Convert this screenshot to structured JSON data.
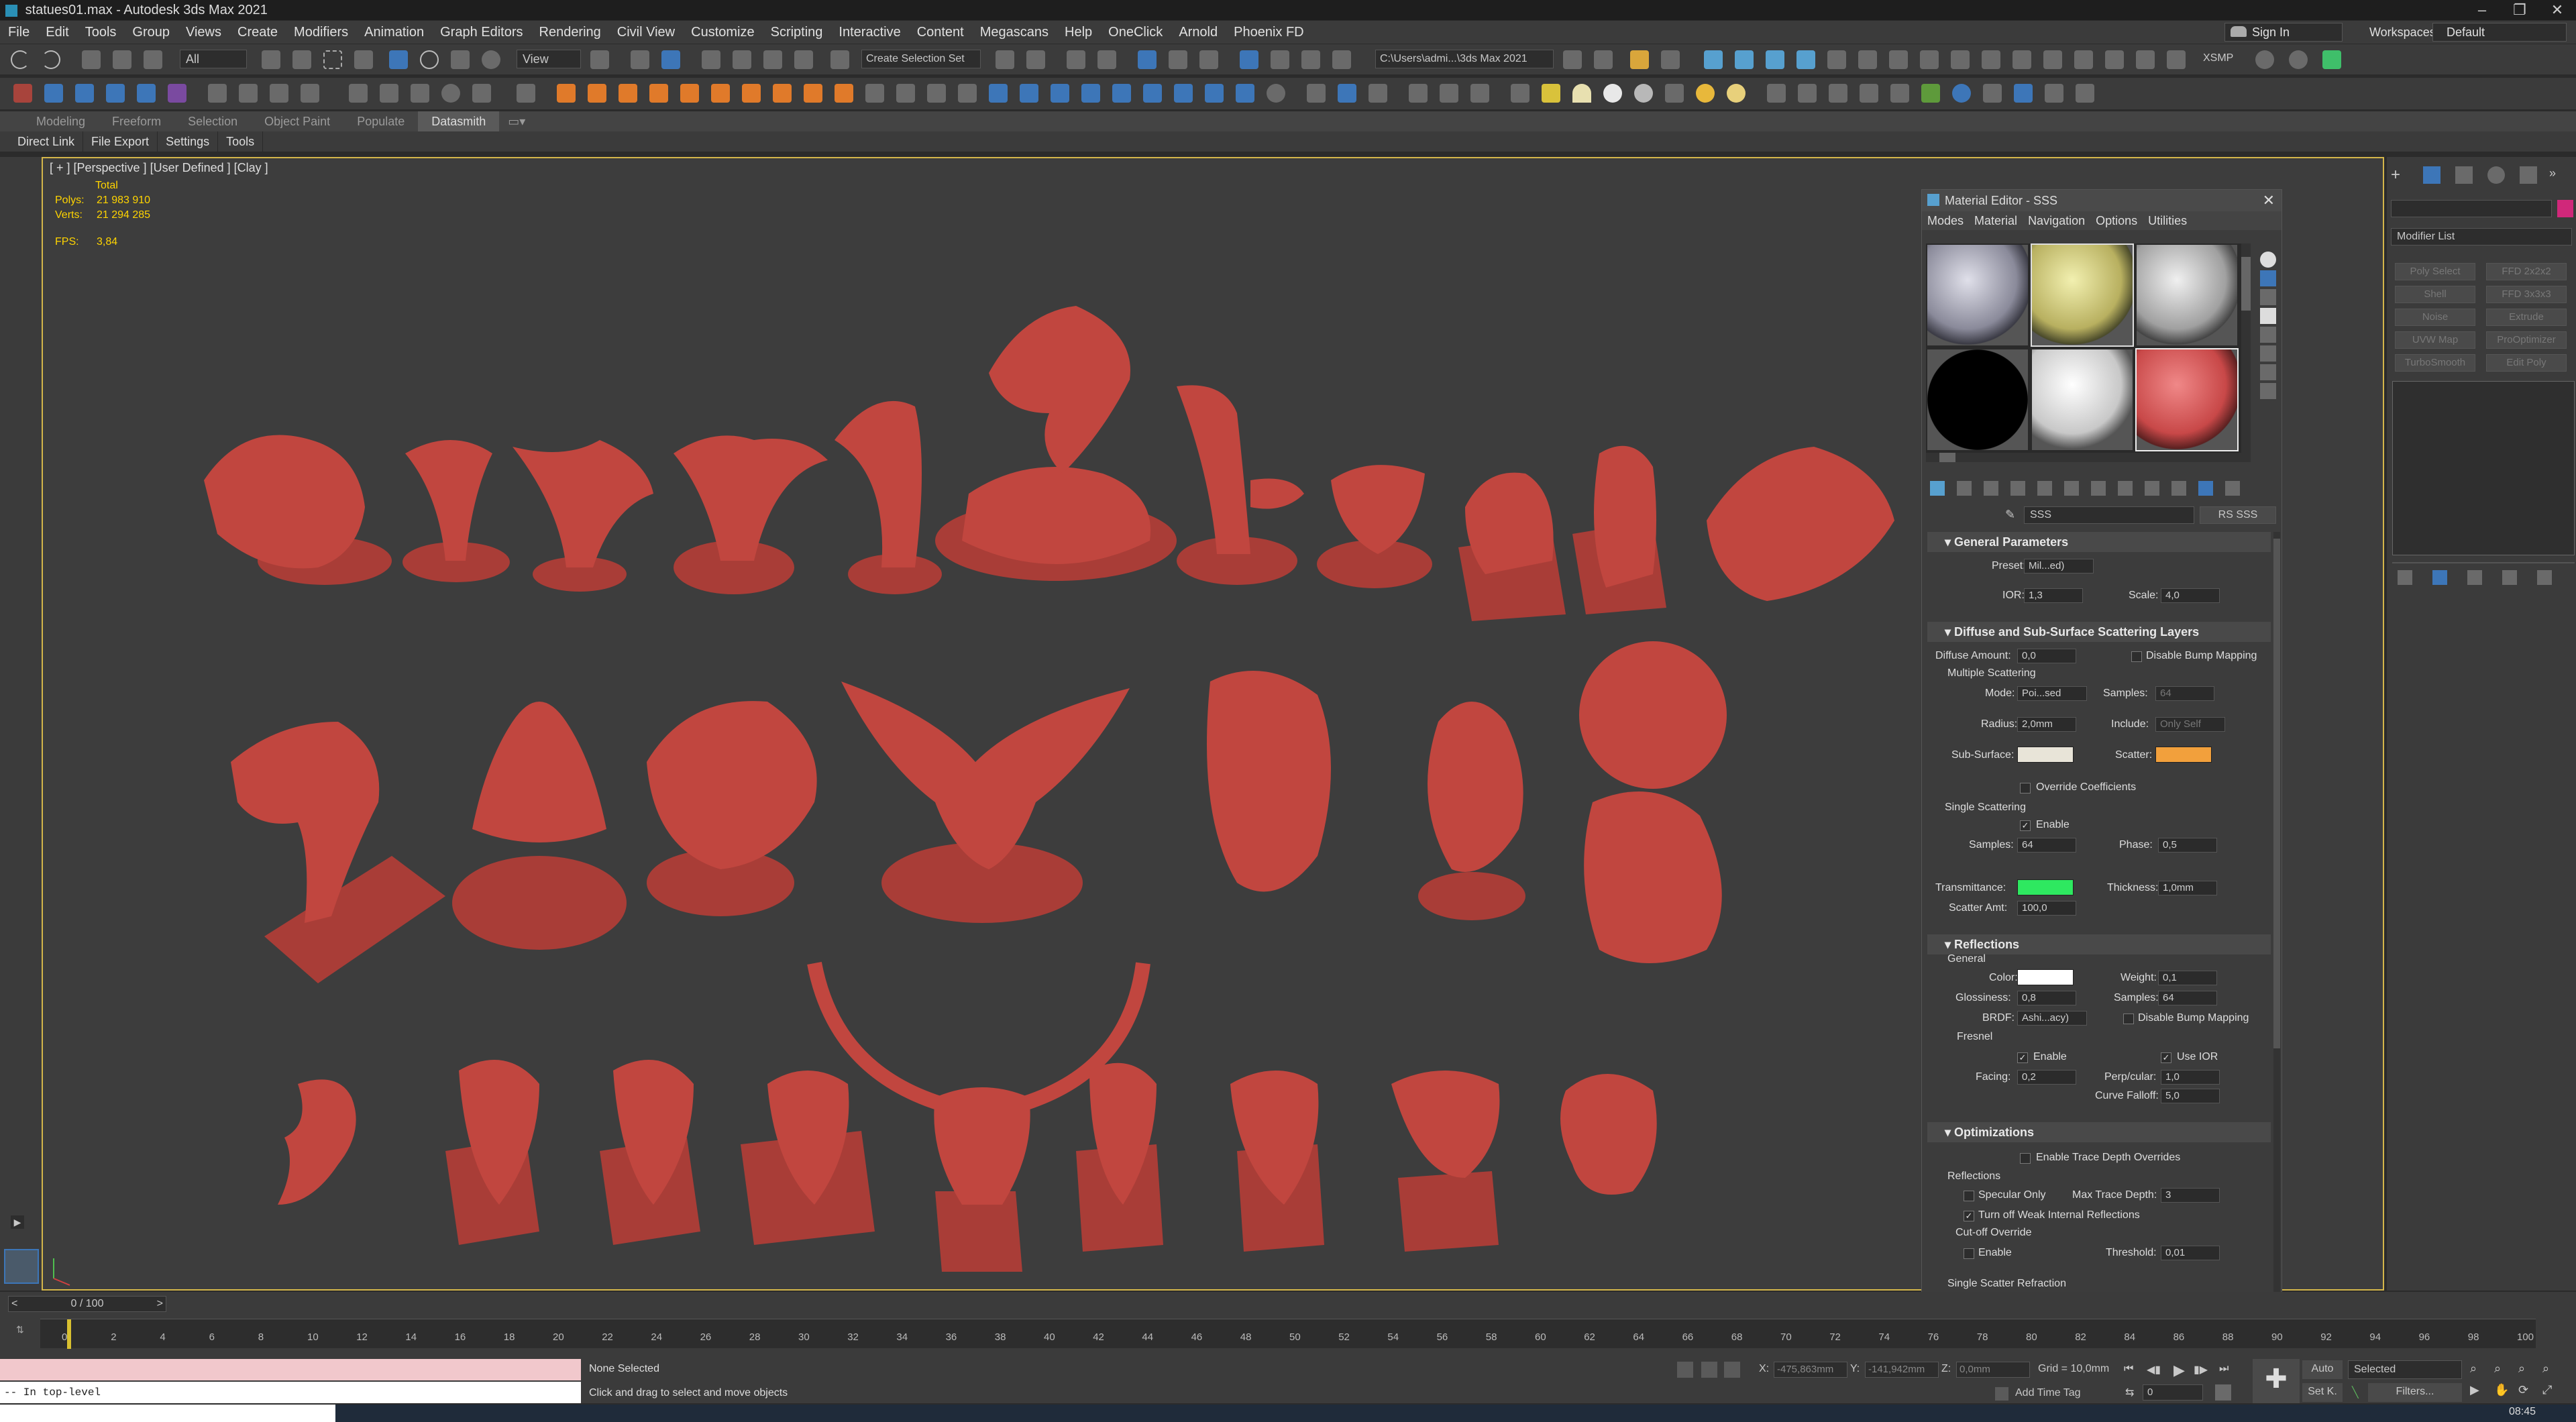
{
  "window": {
    "title": "statues01.max - Autodesk 3ds Max 2021"
  },
  "menu": [
    "File",
    "Edit",
    "Tools",
    "Group",
    "Views",
    "Create",
    "Modifiers",
    "Animation",
    "Graph Editors",
    "Rendering",
    "Civil View",
    "Customize",
    "Scripting",
    "Interactive",
    "Content",
    "Megascans",
    "Help",
    "OneClick",
    "Arnold",
    "Phoenix FD"
  ],
  "account": {
    "sign_in": "Sign In",
    "workspaces_label": "Workspaces:",
    "workspace": "Default"
  },
  "toolbar": {
    "selection_filter": "All",
    "view_dropdown": "View",
    "selection_set": "Create Selection Set",
    "path": "C:\\Users\\admi...\\3ds Max 2021",
    "xsmp": "XSMP"
  },
  "ribbon": {
    "tabs": [
      "Modeling",
      "Freeform",
      "Selection",
      "Object Paint",
      "Populate",
      "Datasmith"
    ]
  },
  "subbar": [
    "Direct Link",
    "File Export",
    "Settings",
    "Tools"
  ],
  "viewport": {
    "label": "[ + ] [Perspective ] [User Defined ] [Clay ]",
    "total": "Total",
    "polys_label": "Polys:",
    "polys": "21 983 910",
    "verts_label": "Verts:",
    "verts": "21 294 285",
    "fps_label": "FPS:",
    "fps": "3,84",
    "statue_color": "#c1463f",
    "bg": "#3d3d3d"
  },
  "material_editor": {
    "title": "Material Editor - SSS",
    "menu": [
      "Modes",
      "Material",
      "Navigation",
      "Options",
      "Utilities"
    ],
    "material_name": "SSS",
    "material_type": "RS SSS",
    "general": {
      "header": "General Parameters",
      "preset_label": "Preset:",
      "preset": "Mil...ed)",
      "ior_label": "IOR:",
      "ior": "1,3",
      "scale_label": "Scale:",
      "scale": "4,0"
    },
    "diffuse": {
      "header": "Diffuse and Sub-Surface Scattering Layers",
      "diffuse_amount_label": "Diffuse Amount:",
      "diffuse_amount": "0,0",
      "disable_bump": "Disable Bump Mapping",
      "multiple_scattering": "Multiple Scattering",
      "mode_label": "Mode:",
      "mode": "Poi...sed",
      "samples_label": "Samples:",
      "samples": "64",
      "radius_label": "Radius:",
      "radius": "2,0mm",
      "include_label": "Include:",
      "include": "Only Self",
      "subsurface_label": "Sub-Surface:",
      "scatter_label": "Scatter:",
      "override_coeff": "Override Coefficients",
      "single_scattering": "Single Scattering",
      "enable": "Enable",
      "ss_samples_label": "Samples:",
      "ss_samples": "64",
      "phase_label": "Phase:",
      "phase": "0,5",
      "transmittance_label": "Transmittance:",
      "thickness_label": "Thickness:",
      "thickness": "1,0mm",
      "scatter_amt_label": "Scatter Amt:",
      "scatter_amt": "100,0",
      "subsurface_color": "#e8e4d8",
      "scatter_color": "#f2a03c",
      "transmittance_color": "#2ee860"
    },
    "reflections": {
      "header": "Reflections",
      "general": "General",
      "color_label": "Color:",
      "weight_label": "Weight:",
      "weight": "0,1",
      "gloss_label": "Glossiness:",
      "gloss": "0,8",
      "samples_label": "Samples:",
      "samples": "64",
      "brdf_label": "BRDF:",
      "brdf": "Ashi...acy)",
      "disable_bump": "Disable Bump Mapping",
      "fresnel": "Fresnel",
      "enable": "Enable",
      "use_ior": "Use IOR",
      "facing_label": "Facing:",
      "facing": "0,2",
      "perp_label": "Perp/cular:",
      "perp": "1,0",
      "curve_label": "Curve Falloff:",
      "curve": "5,0",
      "color": "#ffffff"
    },
    "optimizations": {
      "header": "Optimizations",
      "trace_depth": "Enable Trace Depth Overrides",
      "reflections": "Reflections",
      "specular_only": "Specular Only",
      "max_trace_label": "Max Trace Depth:",
      "max_trace": "3",
      "weak_internal": "Turn off Weak Internal Reflections",
      "cutoff": "Cut-off Override",
      "enable": "Enable",
      "threshold_label": "Threshold:",
      "threshold": "0,01",
      "single_scatter_refraction": "Single Scatter Refraction"
    }
  },
  "command_panel": {
    "modifier_list": "Modifier List",
    "buttons": [
      "Poly Select",
      "FFD 2x2x2",
      "Shell",
      "FFD 3x3x3",
      "Noise",
      "Extrude",
      "UVW Map",
      "ProOptimizer",
      "TurboSmooth",
      "Edit Poly"
    ]
  },
  "timeline": {
    "frame": "0 / 100",
    "ticks": [
      "0",
      "2",
      "4",
      "6",
      "8",
      "10",
      "12",
      "14",
      "16",
      "18",
      "20",
      "22",
      "24",
      "26",
      "28",
      "30",
      "32",
      "34",
      "36",
      "38",
      "40",
      "42",
      "44",
      "46",
      "48",
      "50",
      "52",
      "54",
      "56",
      "58",
      "60",
      "62",
      "64",
      "66",
      "68",
      "70",
      "72",
      "74",
      "76",
      "78",
      "80",
      "82",
      "84",
      "86",
      "88",
      "90",
      "92",
      "94",
      "96",
      "98",
      "100"
    ]
  },
  "status": {
    "selection": "None Selected",
    "prompt": "Click and drag to select and move objects",
    "script": "-- In top-level",
    "x_label": "X:",
    "x": "-475,863mm",
    "y_label": "Y:",
    "y": "-141,942mm",
    "z_label": "Z:",
    "z": "0,0mm",
    "grid": "Grid = 10,0mm",
    "add_time_tag": "Add Time Tag",
    "auto": "Auto",
    "selected": "Selected",
    "set_k": "Set K.",
    "filters": "Filters...",
    "frame_field": "0",
    "clock": "08:45"
  }
}
